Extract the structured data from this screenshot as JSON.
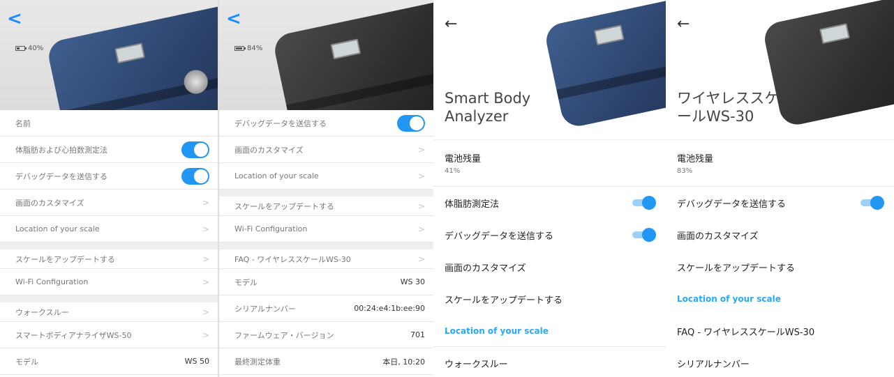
{
  "panel1": {
    "back_glyph": "<",
    "battery_label": "40%",
    "battery_level": 0.4,
    "rows": {
      "name": "名前",
      "body_fat": "体脂肪および心拍数測定法",
      "debug": "デバッグデータを送信する",
      "customize": "画面のカスタマイズ",
      "location": "Location of your scale",
      "update": "スケールをアップデートする",
      "wifi": "Wi-Fi Configuration",
      "walkthrough": "ウォークスルー",
      "product": "スマートボディアナライザWS-50",
      "model_label": "モデル",
      "model_value": "WS 50"
    }
  },
  "panel2": {
    "back_glyph": "<",
    "battery_label": "84%",
    "battery_level": 0.84,
    "rows": {
      "debug": "デバッグデータを送信する",
      "customize": "画面のカスタマイズ",
      "location": "Location of your scale",
      "update": "スケールをアップデートする",
      "wifi": "Wi-Fi Configuration",
      "faq": "FAQ - ワイヤレススケールWS-30",
      "model_label": "モデル",
      "model_value": "WS 30",
      "serial_label": "シリアルナンバー",
      "serial_value": "00:24:e4:1b:ee:90",
      "firmware_label": "ファームウェア・バージョン",
      "firmware_value": "701",
      "last_label": "最終測定体重",
      "last_value": "本日, 10:20"
    }
  },
  "panel3": {
    "back_glyph": "←",
    "title": "Smart Body Analyzer",
    "battery_label": "電池残量",
    "battery_value": "41%",
    "rows": {
      "body_fat": "体脂肪測定法",
      "debug": "デバッグデータを送信する",
      "customize": "画面のカスタマイズ",
      "update": "スケールをアップデートする",
      "location": "Location of your scale",
      "walkthrough": "ウォークスルー"
    }
  },
  "panel4": {
    "back_glyph": "←",
    "title": "ワイヤレススケールWS-30",
    "battery_label": "電池残量",
    "battery_value": "83%",
    "rows": {
      "debug": "デバッグデータを送信する",
      "customize": "画面のカスタマイズ",
      "update": "スケールをアップデートする",
      "location": "Location of your scale",
      "faq": "FAQ - ワイヤレススケールWS-30",
      "serial_label": "シリアルナンバー"
    }
  },
  "colors": {
    "accent_blue": "#2196f3",
    "ios_back": "#1a8cff",
    "link": "#29a8f5",
    "scale_blue": "#2a4068",
    "scale_black": "#2b2b2b"
  },
  "icons": {
    "chevron": "chevron-right-icon",
    "back_ios": "chevron-left-icon",
    "back_android": "arrow-left-icon",
    "battery": "battery-icon"
  }
}
